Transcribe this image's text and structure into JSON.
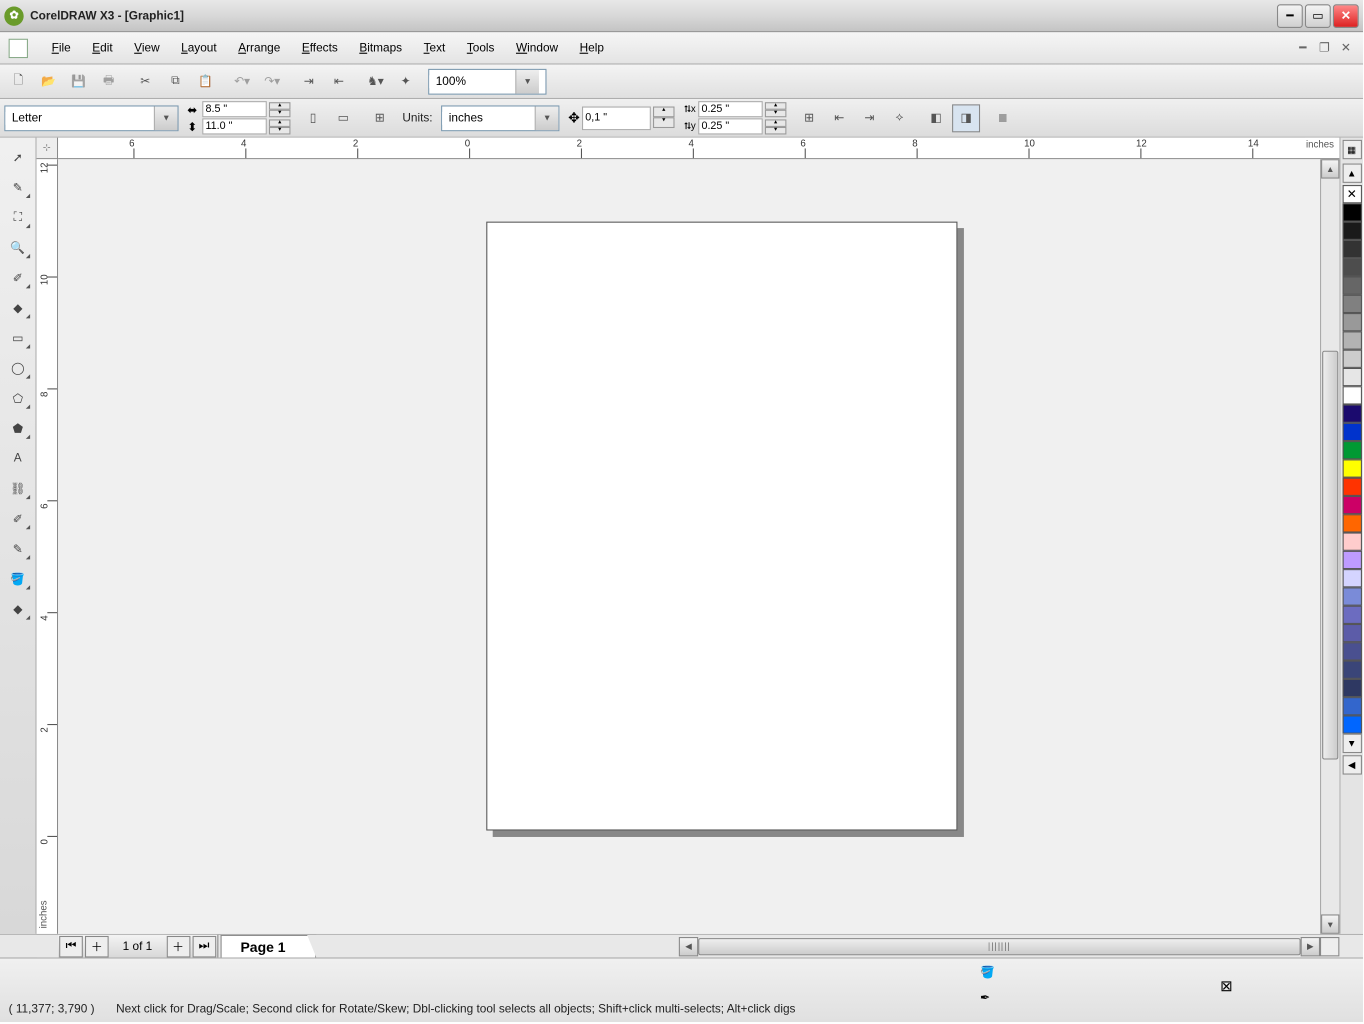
{
  "title": "CorelDRAW X3 - [Graphic1]",
  "menu": [
    "File",
    "Edit",
    "View",
    "Layout",
    "Arrange",
    "Effects",
    "Bitmaps",
    "Text",
    "Tools",
    "Window",
    "Help"
  ],
  "standard_toolbar": {
    "zoom": "100%"
  },
  "property_bar": {
    "page_size": "Letter",
    "width": "8.5 \"",
    "height": "11.0 \"",
    "units_label": "Units:",
    "units": "inches",
    "nudge": "0,1 \"",
    "dup_x": "0.25 \"",
    "dup_y": "0.25 \""
  },
  "ruler": {
    "h_ticks": [
      6,
      4,
      2,
      0,
      2,
      4,
      6,
      8,
      10,
      12,
      14
    ],
    "h_units": "inches",
    "v_ticks": [
      12,
      10,
      8,
      6,
      4,
      2,
      0
    ],
    "v_units": "inches"
  },
  "page_nav": {
    "counter": "1 of 1",
    "tab": "Page 1"
  },
  "palette_colors": [
    "#000000",
    "#1a1a1a",
    "#333333",
    "#4d4d4d",
    "#666666",
    "#808080",
    "#999999",
    "#b3b3b3",
    "#cccccc",
    "#e6e6e6",
    "#ffffff",
    "#1b0a6e",
    "#0033cc",
    "#009933",
    "#ffff00",
    "#ff3300",
    "#cc0066",
    "#ff6600",
    "#ffcccc",
    "#be9bff",
    "#d4d4ff",
    "#7a8bd8",
    "#6c6cc0",
    "#5c5ca8",
    "#4a5090",
    "#3a4578",
    "#2e3862",
    "#3366cc",
    "#0066ff"
  ],
  "status": {
    "coords": "( 11,377;  3,790  )",
    "hint": "Next click for Drag/Scale; Second click for Rotate/Skew; Dbl-clicking tool selects all objects; Shift+click multi-selects; Alt+click digs"
  }
}
